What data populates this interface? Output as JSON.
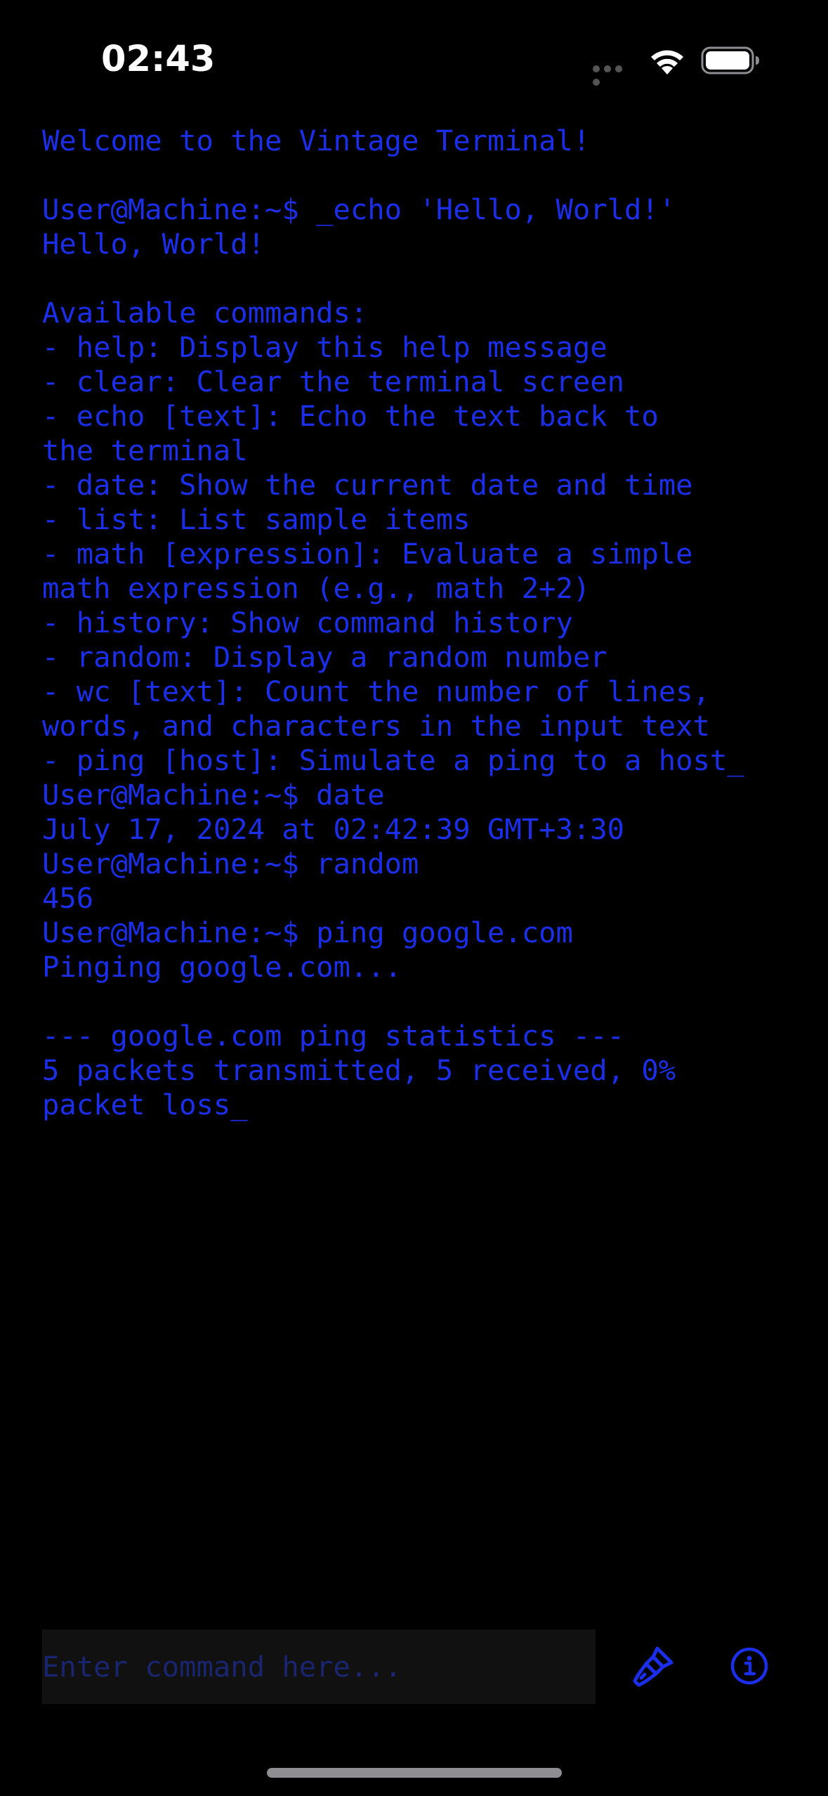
{
  "status_bar": {
    "time": "02:43",
    "icons": [
      "signal-icon",
      "wifi-icon",
      "battery-icon"
    ]
  },
  "terminal": {
    "text_color": "#1b2ee8",
    "background_color": "#000000",
    "lines": [
      "Welcome to the Vintage Terminal!",
      "",
      "User@Machine:~$ _echo 'Hello, World!'",
      "Hello, World!",
      "",
      "Available commands:",
      "- help: Display this help message",
      "- clear: Clear the terminal screen",
      "- echo [text]: Echo the text back to",
      "the terminal",
      "- date: Show the current date and time",
      "- list: List sample items",
      "- math [expression]: Evaluate a simple",
      "math expression (e.g., math 2+2)",
      "- history: Show command history",
      "- random: Display a random number",
      "- wc [text]: Count the number of lines,",
      "words, and characters in the input text",
      "- ping [host]: Simulate a ping to a host_",
      "User@Machine:~$ date",
      "July 17, 2024 at 02:42:39 GMT+3:30",
      "User@Machine:~$ random",
      "456",
      "User@Machine:~$ ping google.com",
      "Pinging google.com...",
      "",
      "--- google.com ping statistics ---",
      "5 packets transmitted, 5 received, 0%",
      "packet loss_"
    ]
  },
  "input": {
    "value": "",
    "placeholder": "Enter command here..."
  },
  "toolbar": {
    "theme_button_icon": "paintbrush-icon",
    "info_button_icon": "info-circle-icon"
  }
}
